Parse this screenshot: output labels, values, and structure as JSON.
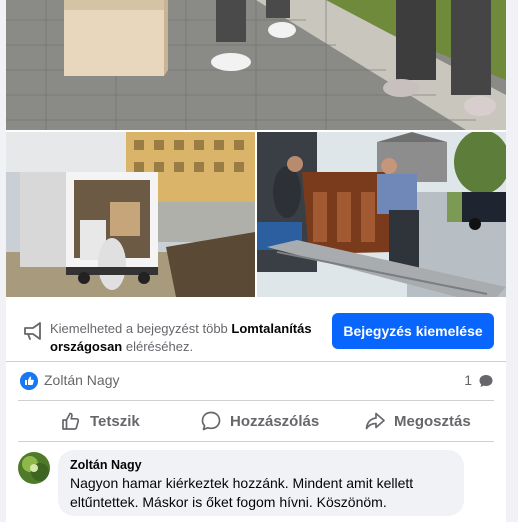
{
  "promo": {
    "text_prefix": "Kiemelheted a bejegyzést több ",
    "page_name": "Lomtalanítás országosan",
    "text_suffix": " eléréséhez.",
    "button_label": "Bejegyzés kiemelése"
  },
  "reactions": {
    "reactor_name": "Zoltán Nagy",
    "comment_count": "1"
  },
  "actions": {
    "like_label": "Tetszik",
    "comment_label": "Hozzászólás",
    "share_label": "Megosztás"
  },
  "comment": {
    "author": "Zoltán Nagy",
    "text": "Nagyon hamar kiérkeztek hozzánk. Mindent amit kellett eltűntettek. Máskor is őket fogom hívni. Köszönöm."
  },
  "colors": {
    "accent": "#0866ff",
    "muted_text": "#65676b",
    "bubble_bg": "#f0f2f5"
  },
  "icons": {
    "promo": "megaphone-icon",
    "like_badge": "thumbs-up-icon",
    "comment_count": "speech-bubble-icon",
    "like": "thumbs-up-outline-icon",
    "comment": "speech-bubble-outline-icon",
    "share": "share-arrow-icon"
  }
}
